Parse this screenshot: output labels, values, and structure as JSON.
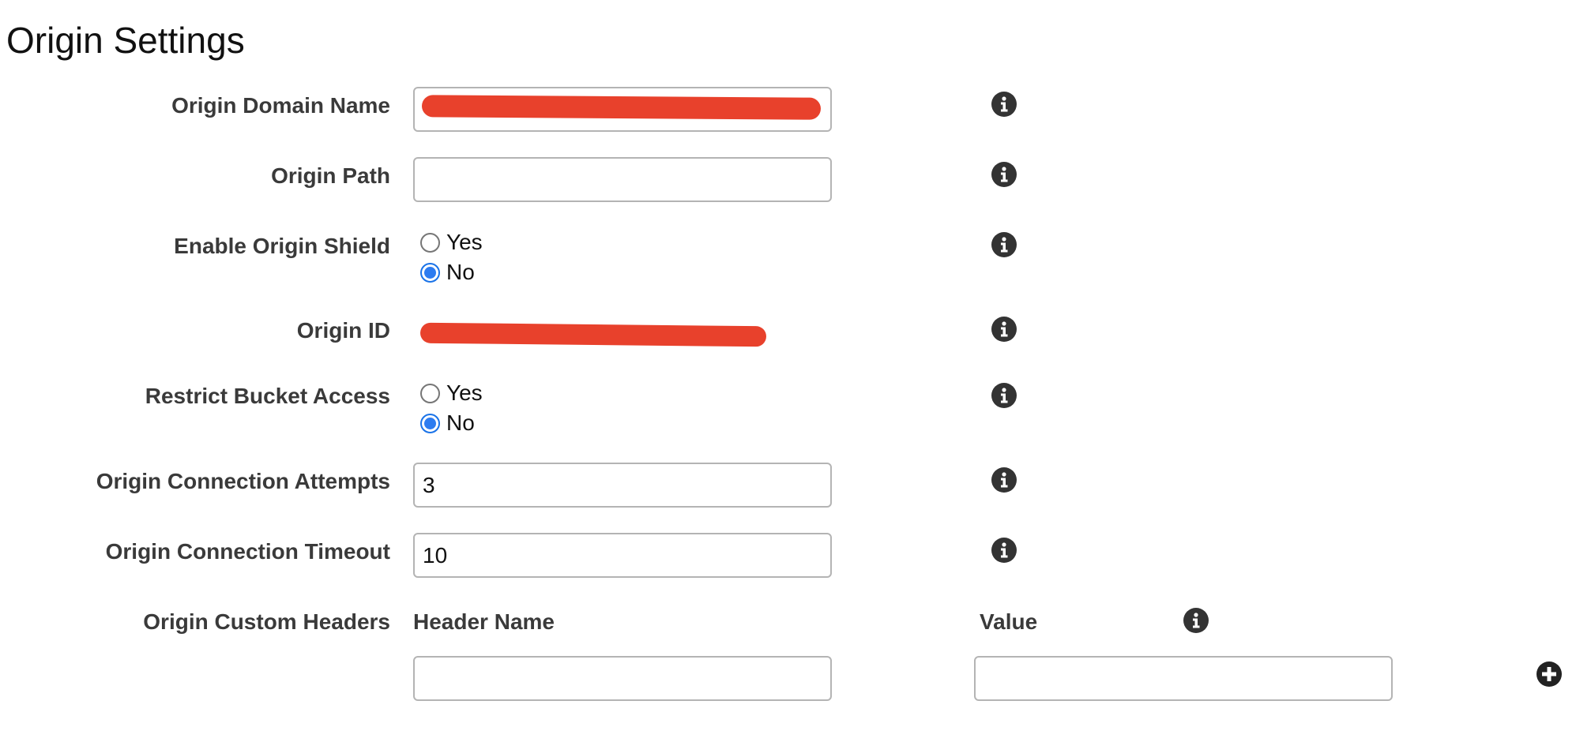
{
  "page": {
    "title": "Origin Settings"
  },
  "fields": {
    "origin_domain_name": {
      "label": "Origin Domain Name",
      "value": ""
    },
    "origin_path": {
      "label": "Origin Path",
      "value": ""
    },
    "enable_origin_shield": {
      "label": "Enable Origin Shield",
      "options": [
        "Yes",
        "No"
      ],
      "selected": "No"
    },
    "origin_id": {
      "label": "Origin ID",
      "value": ""
    },
    "restrict_bucket_access": {
      "label": "Restrict Bucket Access",
      "options": [
        "Yes",
        "No"
      ],
      "selected": "No"
    },
    "origin_connection_attempts": {
      "label": "Origin Connection Attempts",
      "value": "3"
    },
    "origin_connection_timeout": {
      "label": "Origin Connection Timeout",
      "value": "10"
    },
    "origin_custom_headers": {
      "label": "Origin Custom Headers",
      "header_name_label": "Header Name",
      "value_label": "Value",
      "header_name_value": "",
      "value_value": ""
    }
  },
  "icons": {
    "info": "info-circle-icon",
    "add": "plus-circle-icon"
  },
  "colors": {
    "radio_selected": "#2d7cf0",
    "redaction": "#e8412c",
    "label_text": "#3a3a3a",
    "input_border": "#b4b4b4"
  }
}
